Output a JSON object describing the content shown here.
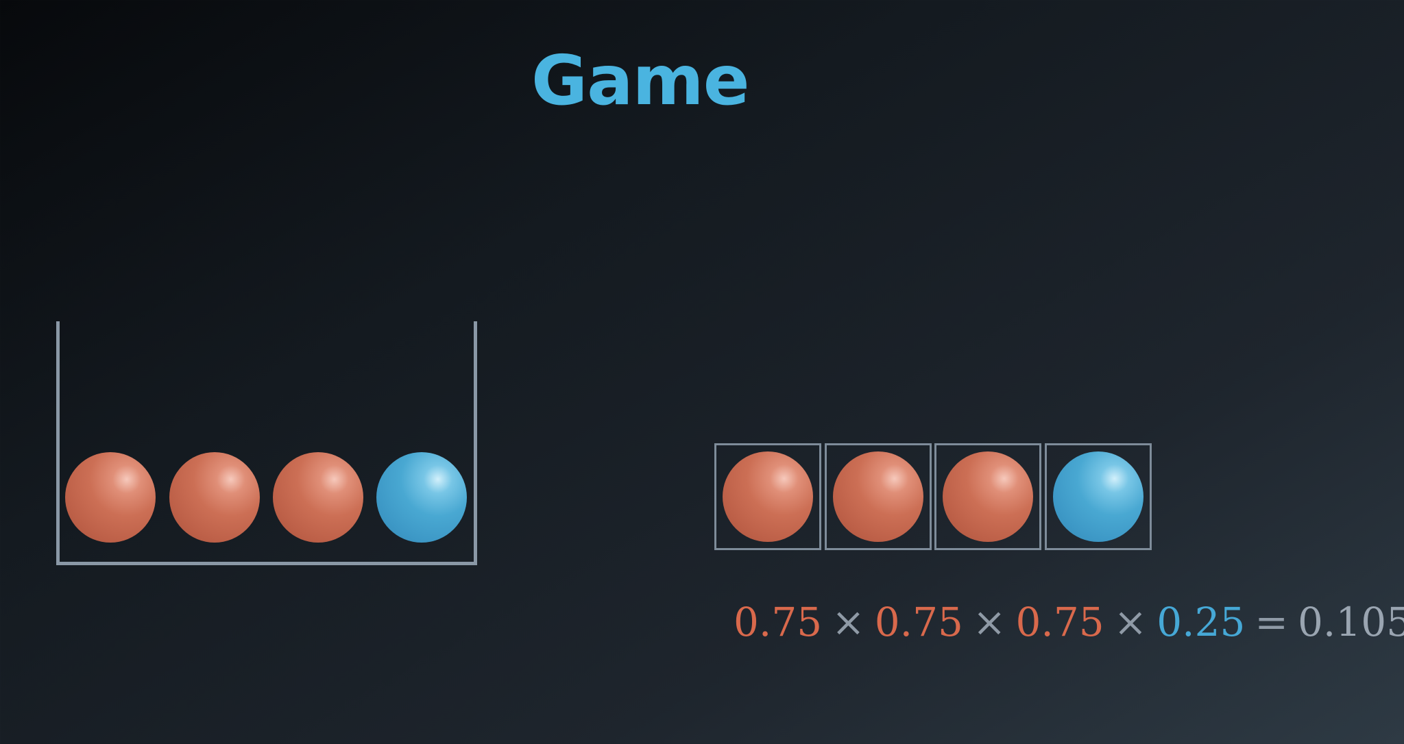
{
  "title": "Game",
  "colors": {
    "accent": "#4ab4e0",
    "red_ball": "#c96a50",
    "blue_ball": "#45a4d2",
    "outline": "#8a98a6"
  },
  "container": {
    "balls": [
      "red",
      "red",
      "red",
      "blue"
    ]
  },
  "sequence": {
    "slots": [
      "red",
      "red",
      "red",
      "blue"
    ]
  },
  "equation": {
    "factors": [
      "0.75",
      "0.75",
      "0.75",
      "0.25"
    ],
    "times": "×",
    "equals": "=",
    "result": "0.105"
  }
}
